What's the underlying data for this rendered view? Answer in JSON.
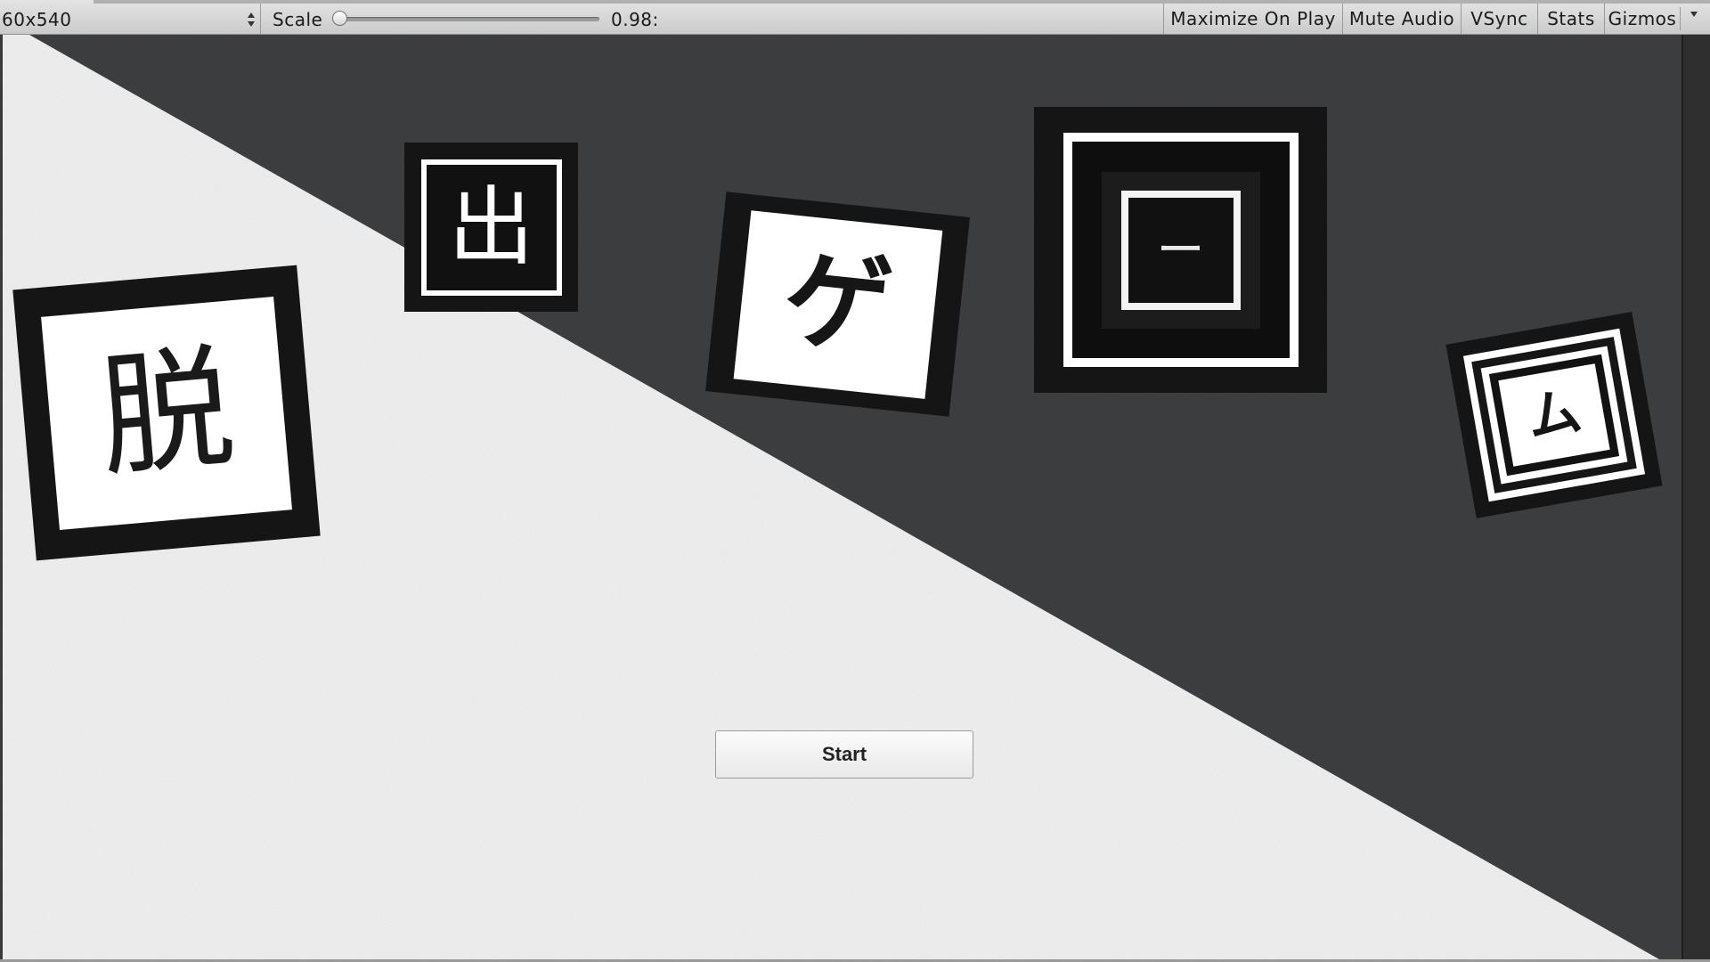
{
  "toolbar": {
    "resolution": "60x540",
    "scale_label": "Scale",
    "scale_value": "0.98:",
    "scale_fraction": 0.0,
    "buttons": {
      "maximize_on_play": "Maximize On Play",
      "mute_audio": "Mute Audio",
      "vsync": "VSync",
      "stats": "Stats",
      "gizmos": "Gizmos"
    }
  },
  "game": {
    "title_chars": [
      "脱",
      "出",
      "ゲ",
      "ー",
      "ム"
    ],
    "start_label": "Start",
    "colors": {
      "light_background": "#f2f2f2",
      "dark_background": "#3e3f41",
      "tile_dark": "#151515",
      "tile_light": "#ffffff"
    }
  }
}
